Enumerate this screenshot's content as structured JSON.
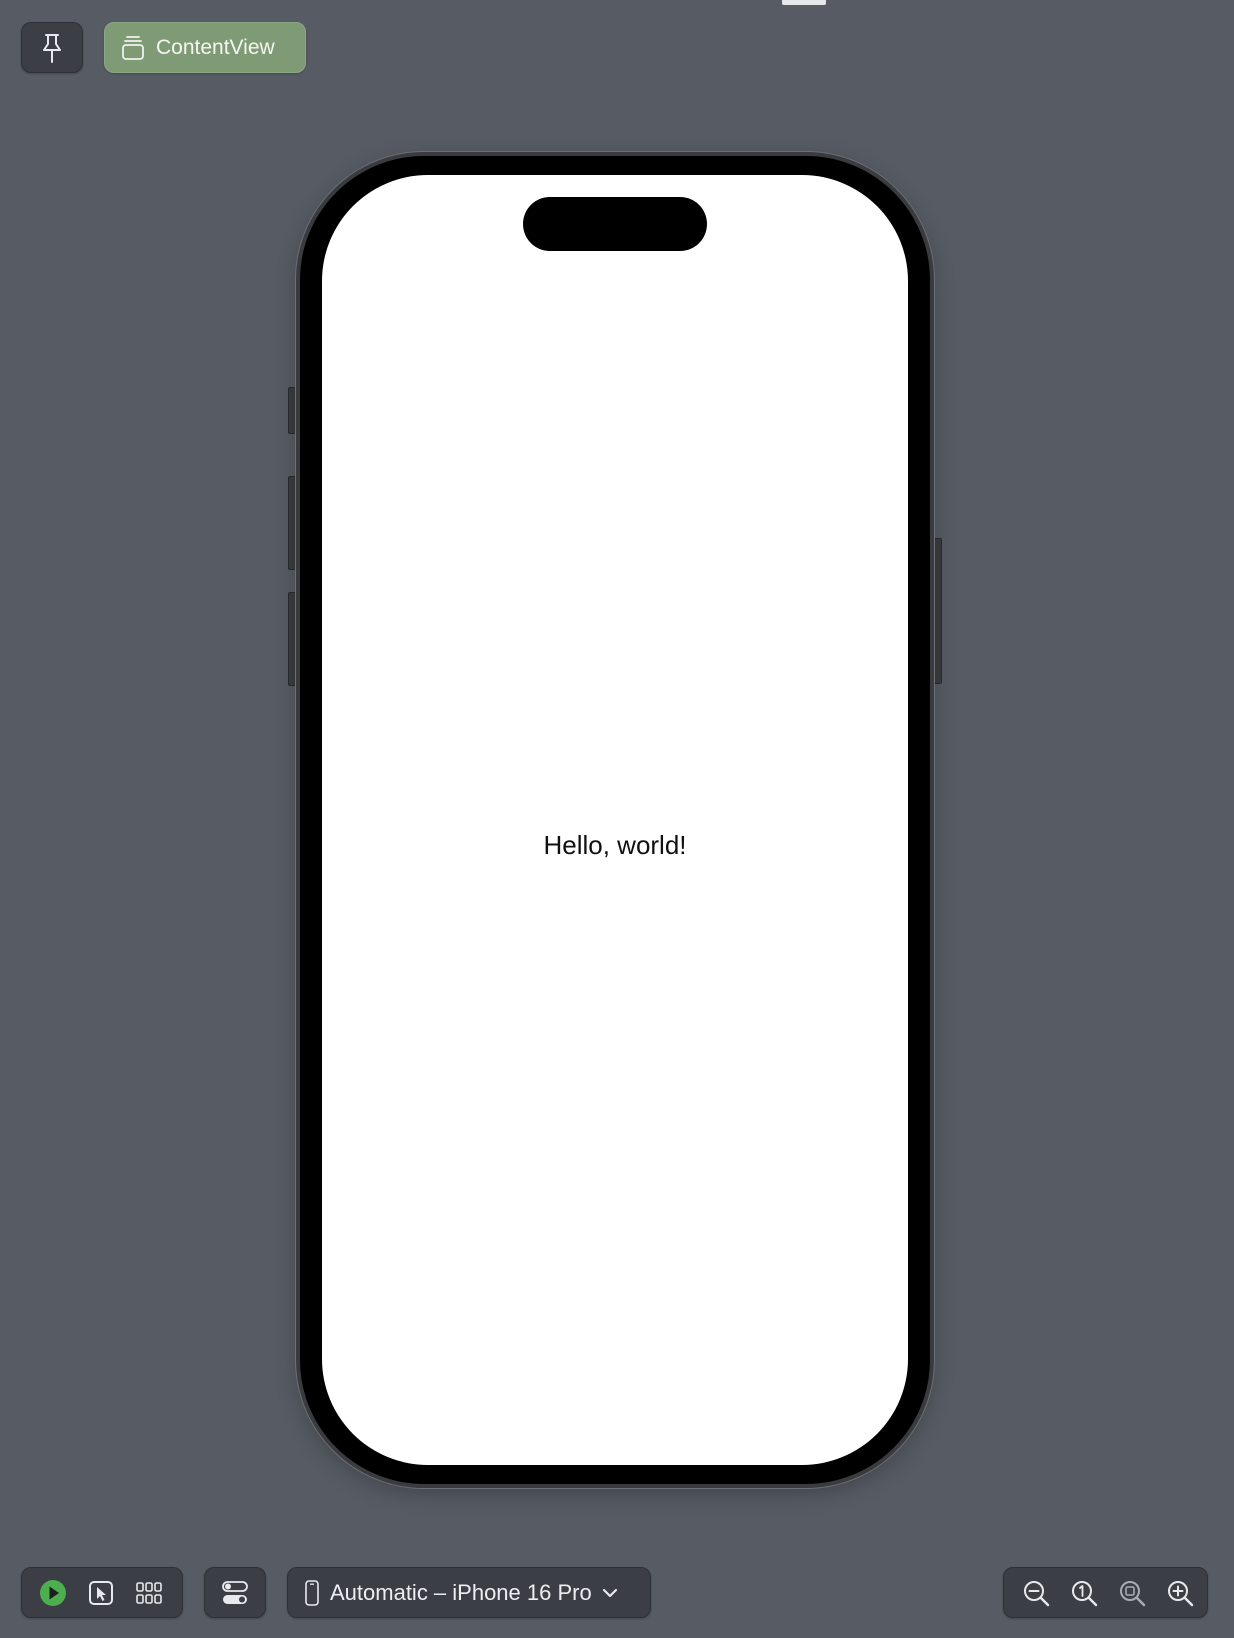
{
  "preview": {
    "pin_icon": "pin-icon",
    "tag_icon": "stack-icon",
    "tag_label": "ContentView"
  },
  "screen": {
    "text": "Hello, world!"
  },
  "toolbar": {
    "live_icon": "play-icon",
    "select_icon": "cursor-select-icon",
    "variants_icon": "grid-icon",
    "settings_icon": "toggles-icon",
    "device_icon": "iphone-icon",
    "device_label": "Automatic – iPhone 16 Pro",
    "zoom_icons": [
      "zoom-out-icon",
      "zoom-actual-size-icon",
      "zoom-to-fit-icon",
      "zoom-in-icon"
    ]
  },
  "colors": {
    "canvas": "#575c64",
    "tag": "#7f9b76",
    "live_green": "#4cae4f"
  }
}
